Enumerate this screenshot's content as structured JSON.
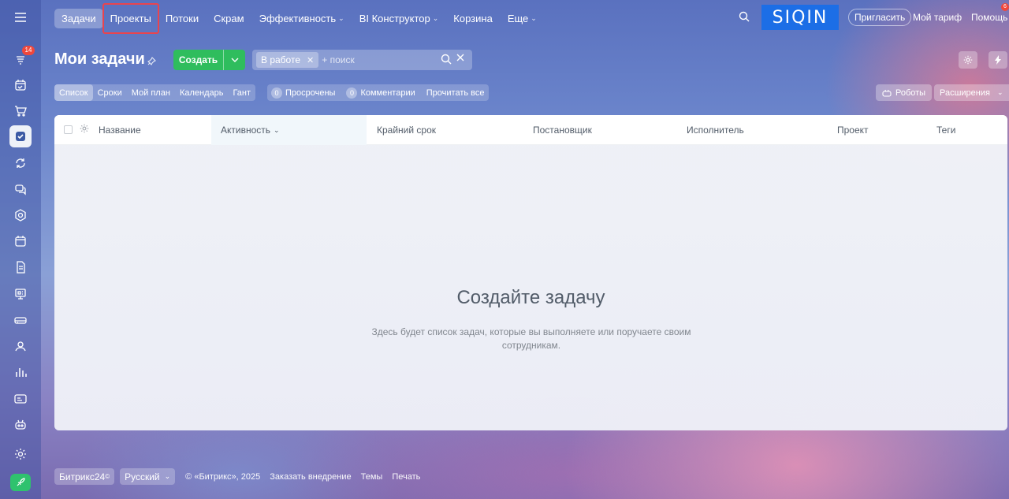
{
  "rail": {
    "menu_icon": "hamburger-icon",
    "items": [
      {
        "name": "feed",
        "icon": "broadcast-icon",
        "badge": "14"
      },
      {
        "name": "calendar-tasks",
        "icon": "calendar-check-icon"
      },
      {
        "name": "shop",
        "icon": "cart-icon"
      },
      {
        "name": "tasks",
        "icon": "checkbox-icon",
        "active": true
      },
      {
        "name": "crm",
        "icon": "sync-icon"
      },
      {
        "name": "messenger",
        "icon": "chat-icon"
      },
      {
        "name": "sites",
        "icon": "hexagon-icon"
      },
      {
        "name": "calendar",
        "icon": "calendar-icon"
      },
      {
        "name": "docs",
        "icon": "document-icon"
      },
      {
        "name": "presentation",
        "icon": "presentation-icon"
      },
      {
        "name": "storage",
        "icon": "drive-icon"
      },
      {
        "name": "team",
        "icon": "users-icon"
      },
      {
        "name": "analytics",
        "icon": "bar-chart-icon"
      },
      {
        "name": "contact-center",
        "icon": "id-card-icon"
      },
      {
        "name": "bots",
        "icon": "robot-icon"
      },
      {
        "name": "settings",
        "icon": "gear-icon"
      },
      {
        "name": "quick-launch",
        "icon": "rocket-icon"
      }
    ]
  },
  "topnav": {
    "tabs": [
      {
        "label": "Задачи",
        "active": true
      },
      {
        "label": "Проекты",
        "highlighted": true
      },
      {
        "label": "Потоки"
      },
      {
        "label": "Скрам"
      },
      {
        "label": "Эффективность",
        "dropdown": true
      },
      {
        "label": "BI Конструктор",
        "dropdown": true
      },
      {
        "label": "Корзина"
      },
      {
        "label": "Еще",
        "dropdown": true
      }
    ],
    "logo_text": "SIQIN",
    "invite_label": "Пригласить",
    "tariff_label": "Мой тариф",
    "help_label": "Помощь",
    "help_badge": "6"
  },
  "page": {
    "title": "Мои задачи",
    "create_label": "Создать",
    "filter_chip": "В работе",
    "filter_placeholder": "+ поиск"
  },
  "views": {
    "items": [
      "Список",
      "Сроки",
      "Мой план",
      "Календарь",
      "Гант"
    ],
    "active": "Список"
  },
  "counters": {
    "overdue_count": "0",
    "overdue_label": "Просрочены",
    "comments_count": "0",
    "comments_label": "Комментарии",
    "read_all_label": "Прочитать все"
  },
  "toolbar": {
    "robots_label": "Роботы",
    "extensions_label": "Расширения"
  },
  "table": {
    "columns": [
      "Название",
      "Активность",
      "Крайний срок",
      "Постановщик",
      "Исполнитель",
      "Проект",
      "Теги"
    ],
    "sorted_column": "Активность"
  },
  "empty_state": {
    "title": "Создайте задачу",
    "description": "Здесь будет список задач, которые вы выполняете или поручаете своим сотрудникам."
  },
  "footer": {
    "brand_label": "Битрикс24",
    "brand_mark": "©",
    "language_label": "Русский",
    "copyright": "© «Битрикс», 2025",
    "links": [
      "Заказать внедрение",
      "Темы",
      "Печать"
    ]
  },
  "colors": {
    "accent_blue": "#1c6ee6",
    "create_green": "#2fbd5d",
    "badge_red": "#f0473c",
    "highlight_red": "#e9444e"
  }
}
